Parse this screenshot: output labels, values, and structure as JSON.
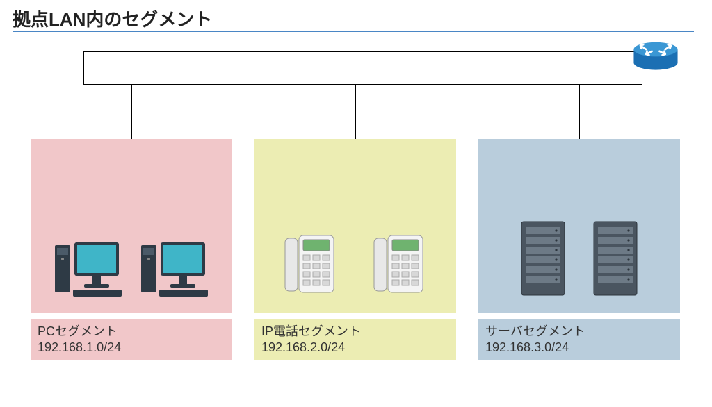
{
  "title": "拠点LAN内のセグメント",
  "segments": [
    {
      "name": "PCセグメント",
      "subnet": "192.168.1.0/24"
    },
    {
      "name": "IP電話セグメント",
      "subnet": "192.168.2.0/24"
    },
    {
      "name": "サーバセグメント",
      "subnet": "192.168.3.0/24"
    }
  ]
}
